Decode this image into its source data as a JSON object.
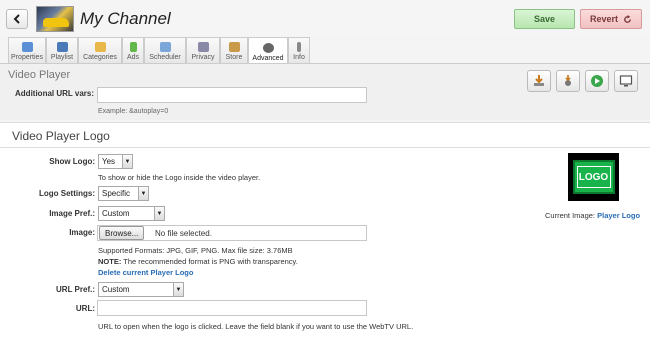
{
  "header": {
    "title": "My Channel",
    "save_label": "Save",
    "revert_label": "Revert"
  },
  "tabs": [
    {
      "label": "Properties",
      "icon": "properties-icon",
      "color": "#5b8fd6"
    },
    {
      "label": "Playlist",
      "icon": "playlist-icon",
      "color": "#4b7ab8"
    },
    {
      "label": "Categories",
      "icon": "folder-icon",
      "color": "#e8b84a"
    },
    {
      "label": "Ads",
      "icon": "ads-icon",
      "color": "#62b84a"
    },
    {
      "label": "Scheduler",
      "icon": "calendar-icon",
      "color": "#7aa7d8"
    },
    {
      "label": "Privacy",
      "icon": "users-icon",
      "color": "#8a8aa8"
    },
    {
      "label": "Store",
      "icon": "store-icon",
      "color": "#c89a4a"
    },
    {
      "label": "Advanced",
      "icon": "gear-icon",
      "color": "#666666"
    },
    {
      "label": "Info",
      "icon": "info-icon",
      "color": "#888888"
    }
  ],
  "active_tab": "Advanced",
  "video_player": {
    "title": "Video Player",
    "url_vars_label": "Additional URL vars:",
    "url_vars_value": "",
    "example": "Example: &autoplay=0"
  },
  "logo": {
    "title": "Video Player Logo",
    "show_logo_label": "Show Logo:",
    "show_logo_value": "Yes",
    "show_logo_hint": "To show or hide the Logo inside the video player.",
    "settings_label": "Logo Settings:",
    "settings_value": "Specific",
    "image_pref_label": "Image Pref.:",
    "image_pref_value": "Custom",
    "image_label": "Image:",
    "browse_label": "Browse...",
    "no_file": "No file selected.",
    "formats": "Supported Formats: JPG, GIF, PNG. Max file size: 3.76MB",
    "note_label": "NOTE:",
    "note_text": "The recommended format is PNG with transparency.",
    "delete_link": "Delete current Player Logo",
    "url_pref_label": "URL Pref.:",
    "url_pref_value": "Custom",
    "url_label": "URL:",
    "url_value": "",
    "url_hint": "URL to open when the logo is clicked. Leave the field blank if you want to use the WebTV URL.",
    "current_image_label": "Current Image:",
    "current_image_link": "Player Logo",
    "logo_text": "LOGO"
  }
}
